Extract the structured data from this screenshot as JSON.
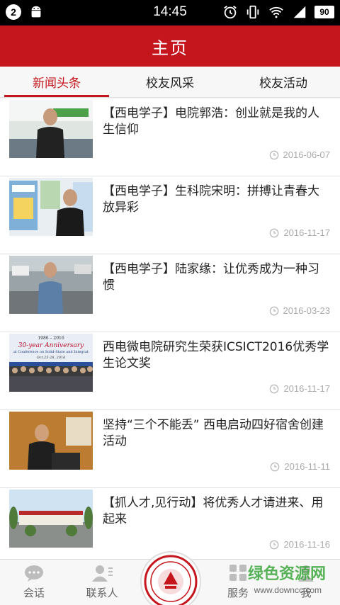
{
  "status_bar": {
    "notification_count": "2",
    "time": "14:45",
    "battery": "90",
    "icons": [
      "android-icon",
      "alarm-icon",
      "vibrate-icon",
      "wifi-icon",
      "signal-icon",
      "battery-icon"
    ]
  },
  "header": {
    "title": "主页"
  },
  "tabs": [
    {
      "label": "新闻头条",
      "active": true
    },
    {
      "label": "校友风采",
      "active": false
    },
    {
      "label": "校友活动",
      "active": false
    }
  ],
  "news": [
    {
      "title": "【西电学子】电院郭浩：创业就是我的人生信仰",
      "date": "2016-06-07"
    },
    {
      "title": "【西电学子】生科院宋明：拼搏让青春大放异彩",
      "date": "2016-11-17"
    },
    {
      "title": "【西电学子】陆家缘：让优秀成为一种习惯",
      "date": "2016-03-23"
    },
    {
      "title": "西电微电院研究生荣获ICSICT2016优秀学生论文奖",
      "date": "2016-11-17"
    },
    {
      "title": "坚持“三个不能丢” 西电启动四好宿舍创建活动",
      "date": "2016-11-11"
    },
    {
      "title": "【抓人才,见行动】将优秀人才请进来、用起来",
      "date": "2016-11-16"
    }
  ],
  "thumb_texts": {
    "anniversary_line1": "1986 – 2016",
    "anniversary_line2": "30-year Anniversary",
    "anniversary_line3": "al Conference on Solid-State and Integrat",
    "anniversary_line4": "Oct.25-28, 2016"
  },
  "bottom_nav": [
    {
      "label": "会话",
      "icon": "chat-icon"
    },
    {
      "label": "联系人",
      "icon": "contacts-icon"
    },
    {
      "label": "服务",
      "icon": "grid-icon"
    },
    {
      "label": "我",
      "icon": "profile-icon"
    }
  ],
  "watermark": {
    "text": "绿色资源网",
    "url": "www.downcc.com"
  },
  "colors": {
    "brand_red": "#c4161c",
    "muted": "#aaaaaa"
  }
}
